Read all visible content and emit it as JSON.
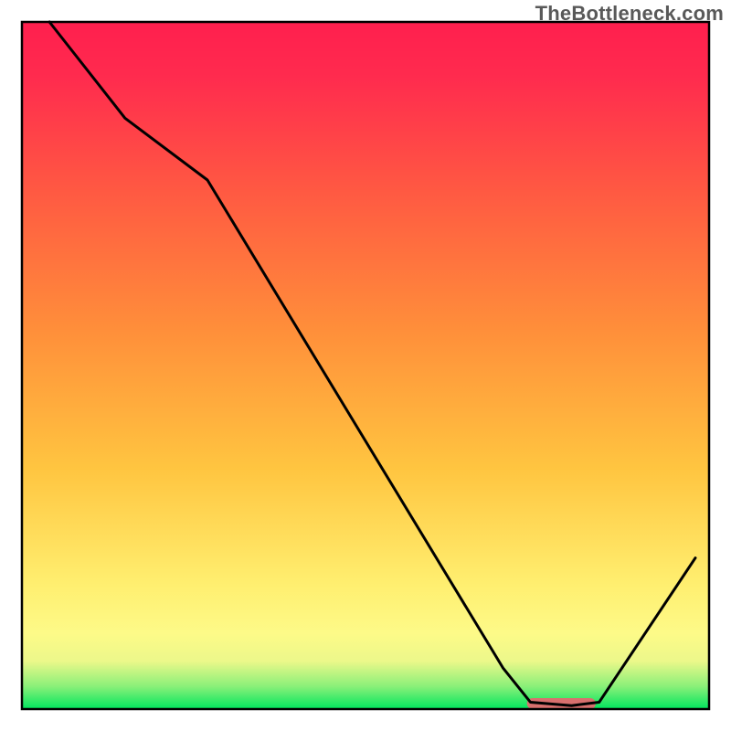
{
  "watermark": "TheBottleneck.com",
  "chart_data": {
    "type": "line",
    "title": "",
    "xlabel": "",
    "ylabel": "",
    "xlim": [
      0,
      100
    ],
    "ylim": [
      0,
      100
    ],
    "gradient_stops": [
      {
        "offset": 0.0,
        "color": "#00e55e"
      },
      {
        "offset": 0.033,
        "color": "#8af079"
      },
      {
        "offset": 0.07,
        "color": "#ecf88a"
      },
      {
        "offset": 0.11,
        "color": "#fdfa88"
      },
      {
        "offset": 0.18,
        "color": "#ffef70"
      },
      {
        "offset": 0.35,
        "color": "#ffc540"
      },
      {
        "offset": 0.55,
        "color": "#ff8f3a"
      },
      {
        "offset": 0.75,
        "color": "#ff5a42"
      },
      {
        "offset": 0.92,
        "color": "#ff2b4e"
      },
      {
        "offset": 1.0,
        "color": "#ff1f4e"
      }
    ],
    "series": [
      {
        "name": "bottleneck-curve",
        "points": [
          {
            "x": 4.0,
            "y": 100.0
          },
          {
            "x": 15.0,
            "y": 86.0
          },
          {
            "x": 27.0,
            "y": 77.0
          },
          {
            "x": 70.0,
            "y": 6.0
          },
          {
            "x": 74.0,
            "y": 1.0
          },
          {
            "x": 80.0,
            "y": 0.5
          },
          {
            "x": 84.0,
            "y": 1.0
          },
          {
            "x": 98.0,
            "y": 22.0
          }
        ]
      }
    ],
    "marker": {
      "name": "optimal-range",
      "x_start": 73.5,
      "x_end": 83.5,
      "y": 0.8,
      "color": "#d8706e"
    },
    "frame": {
      "x": 3,
      "y": 3,
      "w": 94,
      "h": 94,
      "stroke": "#000000",
      "stroke_width": 2.5
    }
  }
}
